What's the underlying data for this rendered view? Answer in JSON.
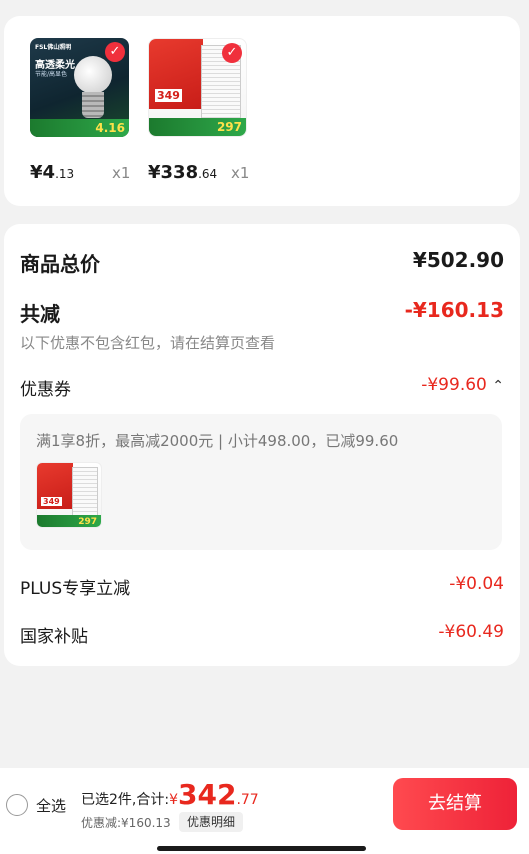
{
  "products": [
    {
      "price_symbol": "¥",
      "price_int": "4",
      "price_dec": ".13",
      "qty": "x1",
      "thumb": {
        "brand": "FSL佛山照明",
        "headline": "高透柔光",
        "sub": "节能/高显色",
        "strip_price": "4.16"
      }
    },
    {
      "price_symbol": "¥",
      "price_int": "338",
      "price_dec": ".64",
      "qty": "x1",
      "thumb": {
        "promo": "349",
        "strip_price": "297"
      }
    }
  ],
  "summary": {
    "goods_total_label": "商品总价",
    "goods_total_value": "¥502.90",
    "total_reduce_label": "共减",
    "total_reduce_value": "-¥160.13",
    "note": "以下优惠不包含红包，请在结算页查看",
    "coupon_label": "优惠券",
    "coupon_value": "-¥99.60",
    "coupon_caret": "⌃",
    "coupon_desc": "满1享8折，最高减2000元 | 小计498.00，已减99.60",
    "plus_label": "PLUS专享立减",
    "plus_value": "-¥0.04",
    "subsidy_label": "国家补贴",
    "subsidy_value": "-¥60.49"
  },
  "bottom": {
    "select_all": "全选",
    "selected_text": "已选2件,合计:",
    "total_symbol": "¥",
    "total_int": "342",
    "total_dec": ".77",
    "discount_text": "优惠减:¥160.13",
    "detail_label": "优惠明细",
    "checkout_label": "去结算"
  },
  "colors": {
    "accent_red": "#e8281e",
    "checkout_gradient_start": "#ff4a4f",
    "checkout_gradient_end": "#ee2238"
  },
  "icons": {
    "product_check": "checkmark-circle-icon",
    "coupon_toggle": "chevron-up-icon",
    "select_all": "radio-unchecked-icon"
  }
}
